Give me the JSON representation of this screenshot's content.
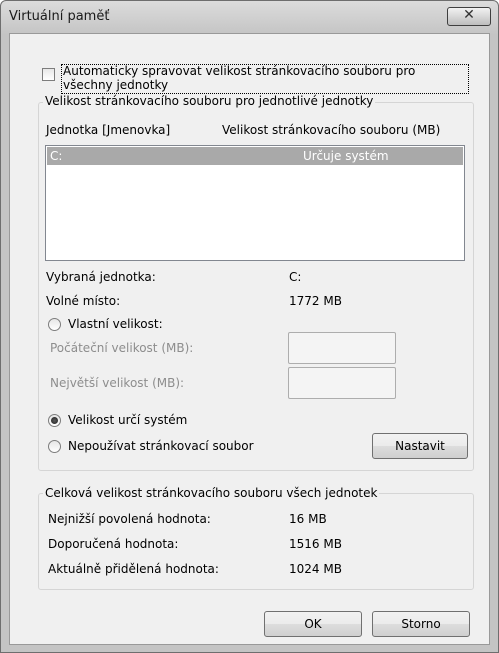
{
  "window": {
    "title": "Virtuální paměť",
    "close_glyph": "✕"
  },
  "auto_manage": {
    "checked": false,
    "label_line1": "Automaticky spravovat velikost stránkovacího souboru pro",
    "label_line2": "všechny jednotky"
  },
  "drive_group": {
    "legend": "Velikost stránkovacího souboru pro jednotlivé jednotky",
    "col_drive": "Jednotka [Jmenovka]",
    "col_size": "Velikost stránkovacího souboru (MB)",
    "rows": [
      {
        "drive": "C:",
        "size": "Určuje systém"
      }
    ],
    "selected_drive_label": "Vybraná jednotka:",
    "selected_drive_value": "C:",
    "free_space_label": "Volné místo:",
    "free_space_value": "1772 MB",
    "custom_size_label": "Vlastní velikost:",
    "initial_size_label": "Počáteční velikost (MB):",
    "max_size_label": "Největší velikost (MB):",
    "system_managed_label": "Velikost určí systém",
    "no_paging_label": "Nepoužívat stránkovací soubor",
    "set_button": "Nastavit",
    "selected_option": "system_managed"
  },
  "total_group": {
    "legend": "Celková velikost stránkovacího souboru všech jednotek",
    "min_label": "Nejnižší povolená hodnota:",
    "min_value": "16 MB",
    "recommended_label": "Doporučená hodnota:",
    "recommended_value": "1516 MB",
    "current_label": "Aktuálně přidělená hodnota:",
    "current_value": "1024 MB"
  },
  "buttons": {
    "ok": "OK",
    "cancel": "Storno"
  }
}
